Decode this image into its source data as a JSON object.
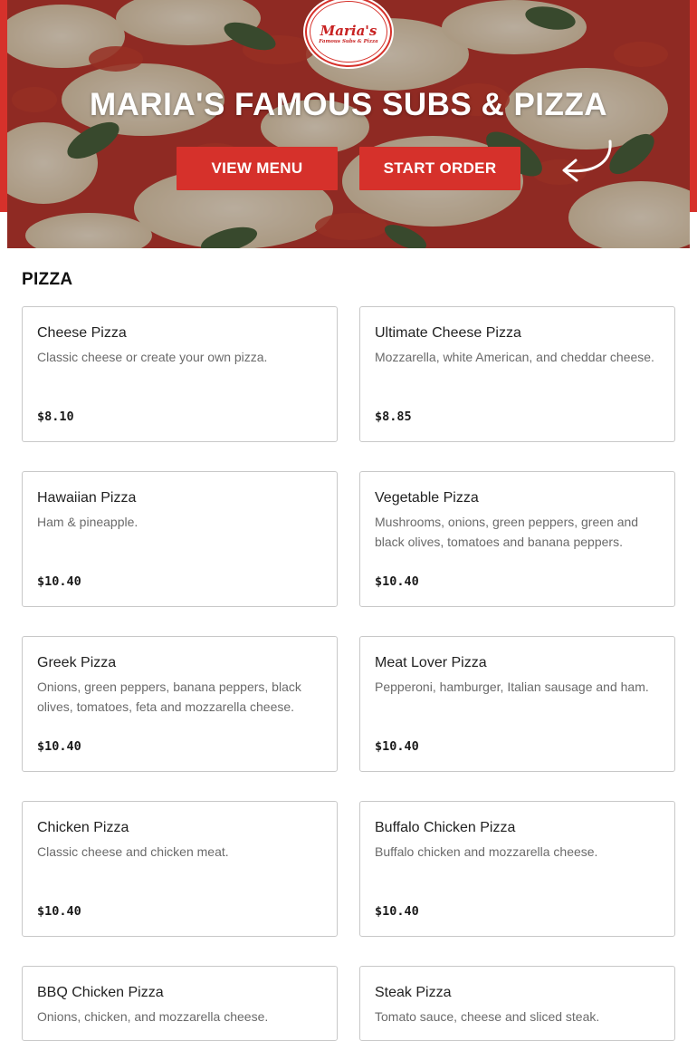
{
  "brand": {
    "logo_name": "Maria's",
    "logo_tagline": "Famous Subs & Pizza",
    "accent_color": "#d6312b"
  },
  "hero": {
    "title": "MARIA'S FAMOUS SUBS & PIZZA",
    "view_menu_label": "VIEW MENU",
    "start_order_label": "START ORDER"
  },
  "menu": {
    "section_title": "PIZZA",
    "items": [
      {
        "name": "Cheese Pizza",
        "description": "Classic cheese or create your own pizza.",
        "price": "$8.10"
      },
      {
        "name": "Ultimate Cheese Pizza",
        "description": "Mozzarella, white American, and cheddar cheese.",
        "price": "$8.85"
      },
      {
        "name": "Hawaiian Pizza",
        "description": "Ham & pineapple.",
        "price": "$10.40"
      },
      {
        "name": "Vegetable Pizza",
        "description": "Mushrooms, onions, green peppers, green and black olives, tomatoes and banana peppers.",
        "price": "$10.40"
      },
      {
        "name": "Greek Pizza",
        "description": "Onions, green peppers, banana peppers, black olives, tomatoes, feta and mozzarella cheese.",
        "price": "$10.40"
      },
      {
        "name": "Meat Lover Pizza",
        "description": "Pepperoni, hamburger, Italian sausage and ham.",
        "price": "$10.40"
      },
      {
        "name": "Chicken Pizza",
        "description": "Classic cheese and chicken meat.",
        "price": "$10.40"
      },
      {
        "name": "Buffalo Chicken Pizza",
        "description": "Buffalo chicken and mozzarella cheese.",
        "price": "$10.40"
      },
      {
        "name": "BBQ Chicken Pizza",
        "description": "Onions, chicken, and mozzarella cheese.",
        "price": ""
      },
      {
        "name": "Steak Pizza",
        "description": "Tomato sauce, cheese and sliced steak.",
        "price": ""
      }
    ]
  }
}
